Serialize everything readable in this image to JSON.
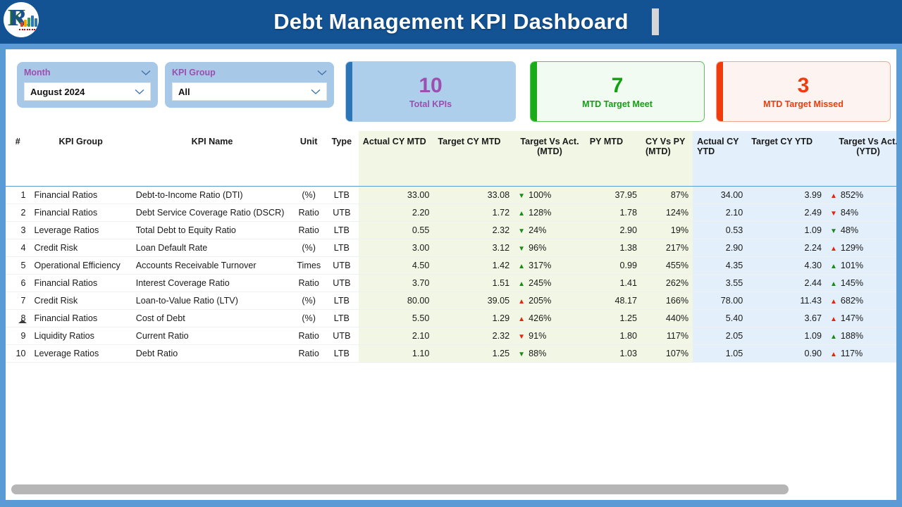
{
  "header": {
    "title": "Debt Management KPI Dashboard",
    "logo_icon": "kpi-bar-chart-logo",
    "caret_icon": "text-caret"
  },
  "filters": [
    {
      "label": "Month",
      "value": "August 2024",
      "name": "month",
      "chevron_icon": "chevron-down-icon"
    },
    {
      "label": "KPI Group",
      "value": "All",
      "name": "kpi-group",
      "chevron_icon": "chevron-down-icon"
    }
  ],
  "cards": [
    {
      "value": "10",
      "label": "Total KPIs",
      "name": "total-kpis",
      "accent": "#2e75b6",
      "bg": "#aecfeb",
      "fg": "#9b4fae",
      "border": "#aecfeb"
    },
    {
      "value": "7",
      "label": "MTD Target Meet",
      "name": "mtd-target-meet",
      "accent": "#1aaa1a",
      "bg": "#f2fbf2",
      "fg": "#14a014",
      "border": "#57c457"
    },
    {
      "value": "3",
      "label": "MTD Target Missed",
      "name": "mtd-target-missed",
      "accent": "#f03c0c",
      "bg": "#fdf3f1",
      "fg": "#f03c0c",
      "border": "#f0a697"
    }
  ],
  "table": {
    "columns": [
      {
        "label": "#",
        "align": "num",
        "band": "none"
      },
      {
        "label": "KPI Group",
        "align": "left",
        "band": "none"
      },
      {
        "label": "KPI Name",
        "align": "left",
        "band": "none"
      },
      {
        "label": "Unit",
        "align": "ctr",
        "band": "none"
      },
      {
        "label": "Type",
        "align": "ctr",
        "band": "none"
      },
      {
        "label": "Actual CY MTD",
        "align": "num",
        "band": "mtd"
      },
      {
        "label": "Target CY MTD",
        "align": "num",
        "band": "mtd"
      },
      {
        "label": "Target Vs Act. (MTD)",
        "align": "cmp",
        "band": "mtd"
      },
      {
        "label": "PY MTD",
        "align": "num",
        "band": "mtd"
      },
      {
        "label": "CY Vs PY (MTD)",
        "align": "num",
        "band": "mtd"
      },
      {
        "label": "Actual CY YTD",
        "align": "num",
        "band": "ytd"
      },
      {
        "label": "Target CY YTD",
        "align": "num",
        "band": "ytd"
      },
      {
        "label": "Target Vs Act. (YTD)",
        "align": "cmp",
        "band": "ytd"
      }
    ],
    "sort_indicator_icon": "sort-ascending-arrow",
    "rows": [
      {
        "num": "1",
        "group": "Financial Ratios",
        "kpi": "Debt-to-Income Ratio (DTI)",
        "unit": "(%)",
        "type": "LTB",
        "actual_cy_mtd": "33.00",
        "target_cy_mtd": "33.08",
        "tva_mtd": "100%",
        "tva_mtd_dir": "down",
        "tva_mtd_color": "green",
        "py_mtd": "37.95",
        "cy_vs_py_mtd": "87%",
        "actual_cy_ytd": "34.00",
        "target_cy_ytd": "3.99",
        "tva_ytd": "852%",
        "tva_ytd_dir": "up",
        "tva_ytd_color": "red"
      },
      {
        "num": "2",
        "group": "Financial Ratios",
        "kpi": "Debt Service Coverage Ratio (DSCR)",
        "unit": "Ratio",
        "type": "UTB",
        "actual_cy_mtd": "2.20",
        "target_cy_mtd": "1.72",
        "tva_mtd": "128%",
        "tva_mtd_dir": "up",
        "tva_mtd_color": "green",
        "py_mtd": "1.78",
        "cy_vs_py_mtd": "124%",
        "actual_cy_ytd": "2.10",
        "target_cy_ytd": "2.49",
        "tva_ytd": "84%",
        "tva_ytd_dir": "down",
        "tva_ytd_color": "red"
      },
      {
        "num": "3",
        "group": "Leverage Ratios",
        "kpi": "Total Debt to Equity Ratio",
        "unit": "Ratio",
        "type": "LTB",
        "actual_cy_mtd": "0.55",
        "target_cy_mtd": "2.32",
        "tva_mtd": "24%",
        "tva_mtd_dir": "down",
        "tva_mtd_color": "green",
        "py_mtd": "2.90",
        "cy_vs_py_mtd": "19%",
        "actual_cy_ytd": "0.53",
        "target_cy_ytd": "1.09",
        "tva_ytd": "48%",
        "tva_ytd_dir": "down",
        "tva_ytd_color": "green"
      },
      {
        "num": "4",
        "group": "Credit Risk",
        "kpi": "Loan Default Rate",
        "unit": "(%)",
        "type": "LTB",
        "actual_cy_mtd": "3.00",
        "target_cy_mtd": "3.12",
        "tva_mtd": "96%",
        "tva_mtd_dir": "down",
        "tva_mtd_color": "green",
        "py_mtd": "1.38",
        "cy_vs_py_mtd": "217%",
        "actual_cy_ytd": "2.90",
        "target_cy_ytd": "2.24",
        "tva_ytd": "129%",
        "tva_ytd_dir": "up",
        "tva_ytd_color": "red"
      },
      {
        "num": "5",
        "group": "Operational Efficiency",
        "kpi": "Accounts Receivable Turnover",
        "unit": "Times",
        "type": "UTB",
        "actual_cy_mtd": "4.50",
        "target_cy_mtd": "1.42",
        "tva_mtd": "317%",
        "tva_mtd_dir": "up",
        "tva_mtd_color": "green",
        "py_mtd": "0.99",
        "cy_vs_py_mtd": "455%",
        "actual_cy_ytd": "4.35",
        "target_cy_ytd": "4.30",
        "tva_ytd": "101%",
        "tva_ytd_dir": "up",
        "tva_ytd_color": "green"
      },
      {
        "num": "6",
        "group": "Financial Ratios",
        "kpi": "Interest Coverage Ratio",
        "unit": "Ratio",
        "type": "UTB",
        "actual_cy_mtd": "3.70",
        "target_cy_mtd": "1.51",
        "tva_mtd": "245%",
        "tva_mtd_dir": "up",
        "tva_mtd_color": "green",
        "py_mtd": "1.41",
        "cy_vs_py_mtd": "262%",
        "actual_cy_ytd": "3.55",
        "target_cy_ytd": "2.44",
        "tva_ytd": "145%",
        "tva_ytd_dir": "up",
        "tva_ytd_color": "green"
      },
      {
        "num": "7",
        "group": "Credit Risk",
        "kpi": "Loan-to-Value Ratio (LTV)",
        "unit": "(%)",
        "type": "LTB",
        "actual_cy_mtd": "80.00",
        "target_cy_mtd": "39.05",
        "tva_mtd": "205%",
        "tva_mtd_dir": "up",
        "tva_mtd_color": "red",
        "py_mtd": "48.17",
        "cy_vs_py_mtd": "166%",
        "actual_cy_ytd": "78.00",
        "target_cy_ytd": "11.43",
        "tva_ytd": "682%",
        "tva_ytd_dir": "up",
        "tva_ytd_color": "red"
      },
      {
        "num": "8",
        "group": "Financial Ratios",
        "kpi": "Cost of Debt",
        "unit": "(%)",
        "type": "LTB",
        "actual_cy_mtd": "5.50",
        "target_cy_mtd": "1.29",
        "tva_mtd": "426%",
        "tva_mtd_dir": "up",
        "tva_mtd_color": "red",
        "py_mtd": "1.25",
        "cy_vs_py_mtd": "440%",
        "actual_cy_ytd": "5.40",
        "target_cy_ytd": "3.67",
        "tva_ytd": "147%",
        "tva_ytd_dir": "up",
        "tva_ytd_color": "red"
      },
      {
        "num": "9",
        "group": "Liquidity Ratios",
        "kpi": "Current Ratio",
        "unit": "Ratio",
        "type": "UTB",
        "actual_cy_mtd": "2.10",
        "target_cy_mtd": "2.32",
        "tva_mtd": "91%",
        "tva_mtd_dir": "down",
        "tva_mtd_color": "red",
        "py_mtd": "1.80",
        "cy_vs_py_mtd": "117%",
        "actual_cy_ytd": "2.05",
        "target_cy_ytd": "1.09",
        "tva_ytd": "188%",
        "tva_ytd_dir": "up",
        "tva_ytd_color": "green"
      },
      {
        "num": "10",
        "group": "Leverage Ratios",
        "kpi": "Debt Ratio",
        "unit": "Ratio",
        "type": "LTB",
        "actual_cy_mtd": "1.10",
        "target_cy_mtd": "1.25",
        "tva_mtd": "88%",
        "tva_mtd_dir": "down",
        "tva_mtd_color": "green",
        "py_mtd": "1.03",
        "cy_vs_py_mtd": "107%",
        "actual_cy_ytd": "1.05",
        "target_cy_ytd": "0.90",
        "tva_ytd": "117%",
        "tva_ytd_dir": "up",
        "tva_ytd_color": "red"
      }
    ]
  },
  "scrollbar": {
    "name": "horizontal-scrollbar",
    "thumb_fraction": 0.885
  }
}
